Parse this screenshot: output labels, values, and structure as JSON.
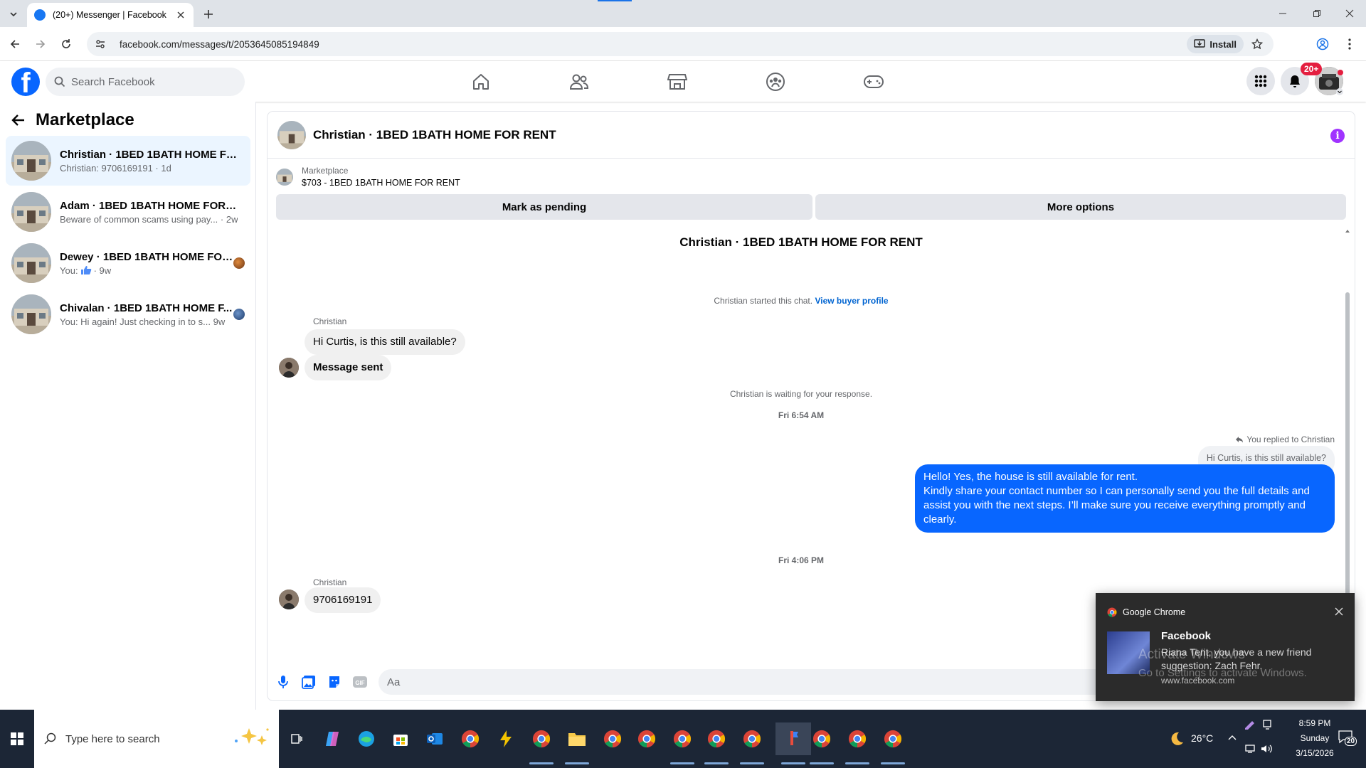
{
  "browser": {
    "tab_title": "(20+) Messenger | Facebook",
    "url": "facebook.com/messages/t/2053645085194849",
    "install_label": "Install"
  },
  "fb": {
    "search_placeholder": "Search Facebook",
    "notifications_badge": "20+"
  },
  "sidebar": {
    "title": "Marketplace",
    "conversations": [
      {
        "name": "Christian · 1BED 1BATH HOME FOR...",
        "preview": "Christian: 9706169191 · 1d"
      },
      {
        "name": "Adam · 1BED 1BATH HOME FOR RE...",
        "preview": "Beware of common scams using pay...",
        "time": "· 2w"
      },
      {
        "name": "Dewey · 1BED 1BATH HOME FOR...",
        "preview": "You:",
        "time": "· 9w"
      },
      {
        "name": "Chivalan · 1BED 1BATH HOME F...",
        "preview": "You: Hi again! Just checking in to s...",
        "time": "9w"
      }
    ]
  },
  "chat": {
    "title": "Christian · 1BED 1BATH HOME FOR RENT",
    "listing_source": "Marketplace",
    "listing_line": "$703 - 1BED 1BATH HOME FOR RENT",
    "mark_pending": "Mark as pending",
    "more_options": "More options",
    "thread_title": "Christian · 1BED 1BATH HOME FOR RENT",
    "started_text": "Christian started this chat.",
    "view_profile": "View buyer profile",
    "sender_name": "Christian",
    "msg1": "Hi Curtis, is this still available?",
    "msg2": "Message sent",
    "waiting": "Christian is waiting for your response.",
    "time1": "Fri 6:54 AM",
    "replied_to": "You replied to Christian",
    "quoted": "Hi Curtis, is this still available?",
    "reply_lines": [
      "Hello! Yes, the house is still available for rent.",
      "Kindly share your contact number so I can personally send you the full details and",
      "assist you with the next steps. I’ll make sure you receive everything promptly and",
      "clearly."
    ],
    "time2": "Fri 4:06 PM",
    "sender_name2": "Christian",
    "msg3": "9706169191",
    "composer_placeholder": "Aa"
  },
  "toast": {
    "app": "Google Chrome",
    "title": "Facebook",
    "body": "Riana Tent, you have a new friend suggestion: Zach Fehr.",
    "source": "www.facebook.com"
  },
  "watermark": {
    "line1": "Activate Windows",
    "line2": "Go to Settings to activate Windows."
  },
  "taskbar": {
    "search_placeholder": "Type here to search",
    "weather": "26°C",
    "time": "8:59 PM",
    "day": "Sunday",
    "date": "3/15/2026",
    "notif_count": "20"
  },
  "colors": {
    "fb_blue": "#0866ff",
    "active_conv_bg": "#ebf5ff",
    "badge_red": "#e41e3f",
    "info_purple": "#a033ff"
  }
}
